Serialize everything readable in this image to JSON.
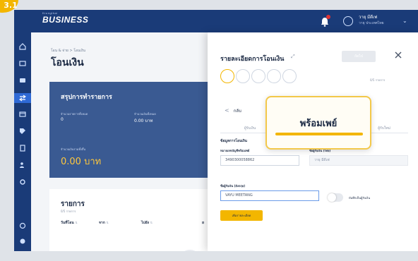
{
  "badge": "3.1",
  "topbar": {
    "brand": "BUSINESS",
    "brand_small": "Krungthai",
    "user_name": "วายุ มีดีเพ่",
    "user_company": "วายุ ประเทศไทย"
  },
  "main": {
    "breadcrumb": "โอน & จ่าย > โอนเงิน",
    "title": "โอนเงิน",
    "summary": {
      "title": "สรุปการทำรายการ",
      "count_label": "จำนวนรายการทั้งหมด",
      "count_value": "0",
      "amount_label": "จำนวนเงินทั้งหมด",
      "amount_value": "0.00 บาท",
      "total_label": "จำนวนเงินรวมทั้งสิ้น",
      "total_value": "0.00 บาท"
    },
    "transactions": {
      "title": "รายการ",
      "subtitle": "0/5 รายการ",
      "columns": [
        "วันที่โอน",
        "จาก",
        "ไปยัง",
        "ย"
      ]
    }
  },
  "panel": {
    "title": "รายละเอียดการโอนเงิน",
    "next_label": "ถัดไป",
    "progress": "0/5 รายการ",
    "back_label": "กลับ",
    "tab_left": "ผู้รับเงิน",
    "tab_right": "ผู้รับใหม่",
    "section_title": "ข้อมูลการโอนเงิน",
    "account_label": "หมายเลขบัญชีพร้อมเพย์",
    "account_value": "3490300058862",
    "recipient_label": "ชื่อผู้รับเงิน (ไทย)",
    "recipient_value": "วายุ มีดีเพ่",
    "name_en_label": "ชื่อผู้รับเงิน (อังกฤษ)",
    "name_en_value": "VAYU MEETANG",
    "save_label": "บันทึกเป็นผู้รับเงิน",
    "add_label": "เพิ่มรายละเอียด"
  },
  "callout": {
    "text": "พร้อมเพย์"
  },
  "colors": {
    "navy": "#1a3b78",
    "accent": "#f3b600",
    "active_blue": "#2f6ad6"
  }
}
